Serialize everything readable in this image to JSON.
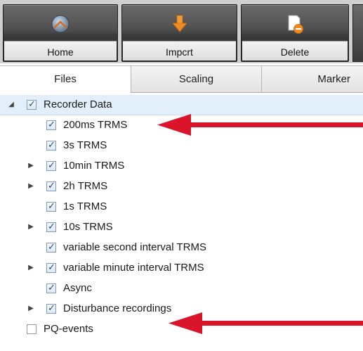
{
  "toolbar": {
    "home_label": "Home",
    "import_label": "Impcrt",
    "delete_label": "Delete"
  },
  "tabs": [
    {
      "label": "Files",
      "active": true
    },
    {
      "label": "Scaling",
      "active": false
    },
    {
      "label": "Marker",
      "active": false
    }
  ],
  "tree": {
    "root": {
      "label": "Recorder Data",
      "checked": true,
      "expanded": true
    },
    "items": [
      {
        "label": "200ms TRMS",
        "checked": true,
        "has_children": false
      },
      {
        "label": "3s TRMS",
        "checked": true,
        "has_children": false
      },
      {
        "label": "10min TRMS",
        "checked": true,
        "has_children": true
      },
      {
        "label": "2h TRMS",
        "checked": true,
        "has_children": true
      },
      {
        "label": "1s TRMS",
        "checked": true,
        "has_children": false
      },
      {
        "label": "10s TRMS",
        "checked": true,
        "has_children": true
      },
      {
        "label": "variable second interval TRMS",
        "checked": true,
        "has_children": false
      },
      {
        "label": "variable minute interval TRMS",
        "checked": true,
        "has_children": true
      },
      {
        "label": "Async",
        "checked": true,
        "has_children": false
      },
      {
        "label": "Disturbance recordings",
        "checked": true,
        "has_children": true
      }
    ],
    "pq_events": {
      "label": "PQ-events",
      "checked": false
    }
  },
  "colors": {
    "arrow": "#d9142b",
    "selection_row": "#e2eef9",
    "import_icon": "#f08a1c",
    "delete_icon": "#f08a1c"
  }
}
